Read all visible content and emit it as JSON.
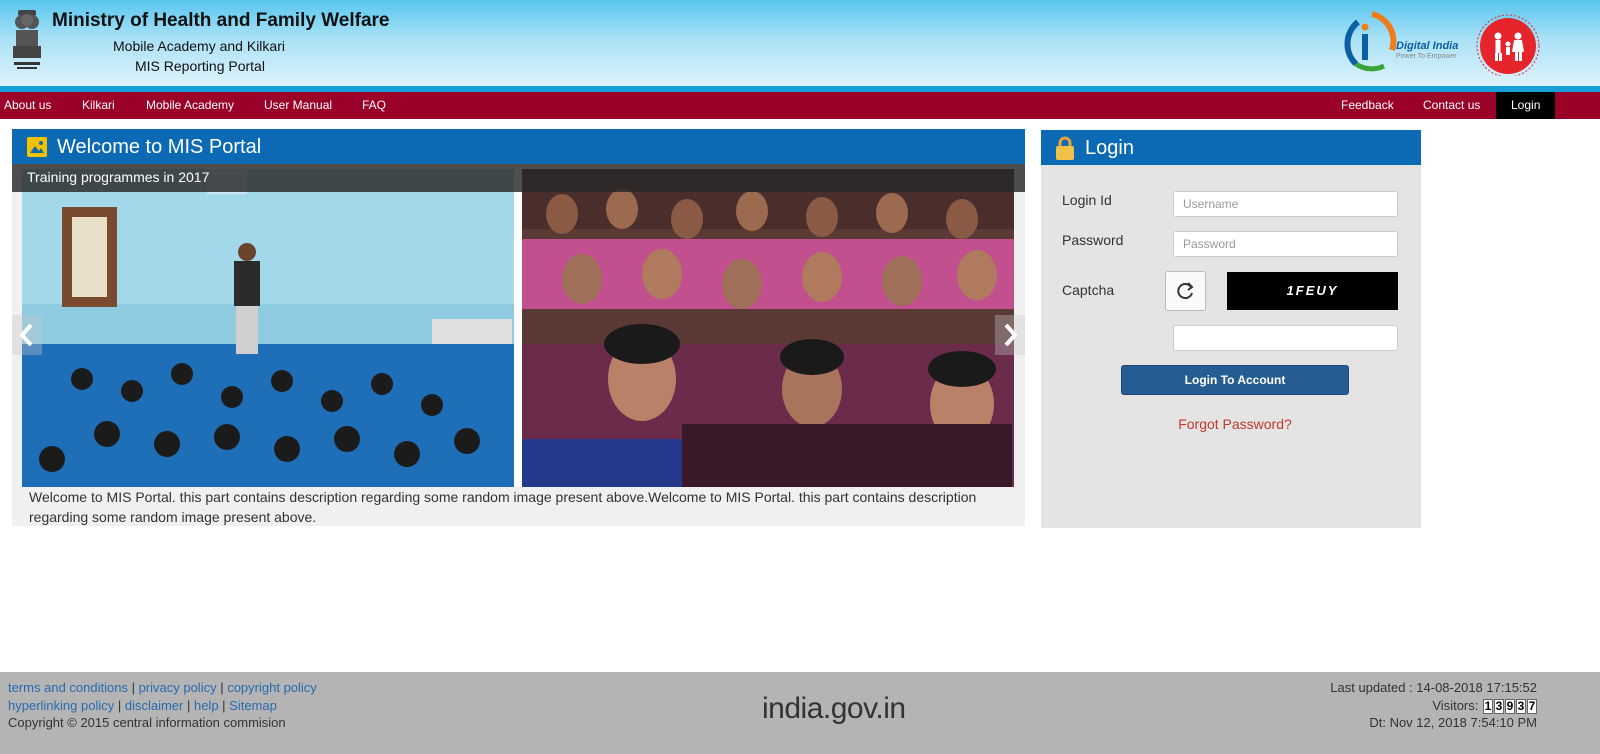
{
  "header": {
    "title": "Ministry of Health and Family Welfare",
    "subtitle1": "Mobile Academy and Kilkari",
    "subtitle2": "MIS Reporting Portal",
    "digital_india": "Digital India",
    "digital_india_tag": "Power To Empower"
  },
  "nav": {
    "left": [
      "About us",
      "Kilkari",
      "Mobile Academy",
      "User Manual",
      "FAQ"
    ],
    "right": [
      "Feedback",
      "Contact us",
      "Login"
    ]
  },
  "welcome": {
    "title": "Welcome to MIS Portal",
    "caption": "Training programmes in 2017",
    "description": "Welcome to MIS Portal. this part contains description regarding some random image present above.Welcome to MIS Portal. this part contains description regarding some random image present above."
  },
  "login": {
    "title": "Login",
    "login_id_label": "Login Id",
    "username_placeholder": "Username",
    "password_label": "Password",
    "password_placeholder": "Password",
    "captcha_label": "Captcha",
    "captcha_text": "1FEUY",
    "submit_label": "Login To Account",
    "forgot_label": "Forgot Password?"
  },
  "footer": {
    "links_row1": [
      "terms and conditions",
      "privacy policy",
      "copyright policy"
    ],
    "links_row2": [
      "hyperlinking policy",
      "disclaimer",
      "help",
      "Sitemap"
    ],
    "copyright": "Copyright © 2015 central information commision",
    "india_gov": "india.gov.in",
    "last_updated": "Last updated : 14-08-2018 17:15:52",
    "visitors_label": "Visitors:",
    "visitors_digits": [
      "1",
      "3",
      "9",
      "3",
      "7"
    ],
    "date": "Dt: Nov 12, 2018 7:54:10 PM"
  },
  "colors": {
    "nav_bg": "#9a0028",
    "panel_head": "#0c6ab5",
    "login_button": "#255d93",
    "forgot_link": "#c0392b",
    "footer_bg": "#b4b4b4"
  }
}
